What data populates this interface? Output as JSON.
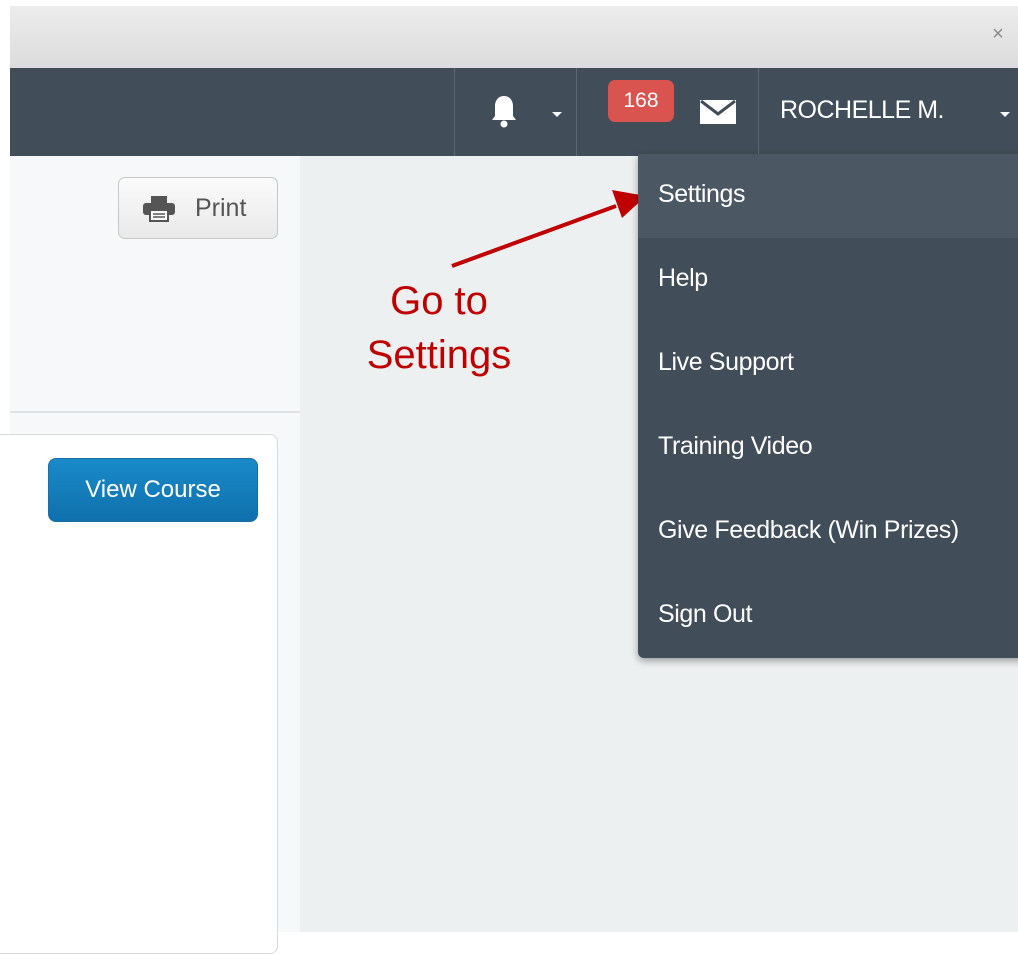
{
  "window": {
    "close_glyph": "×"
  },
  "navbar": {
    "notifications_icon": "bell-icon",
    "messages": {
      "badge_count": "168",
      "icon": "envelope-icon"
    },
    "user": {
      "name": "ROCHELLE M."
    }
  },
  "toolbar": {
    "print_label": "Print",
    "print_icon": "printer-icon"
  },
  "course_card": {
    "view_button_label": "View Course"
  },
  "annotation": {
    "line1": "Go to",
    "line2": "Settings",
    "color": "#c00000"
  },
  "user_menu": {
    "items": [
      {
        "label": "Settings"
      },
      {
        "label": "Help"
      },
      {
        "label": "Live Support"
      },
      {
        "label": "Training Video"
      },
      {
        "label": "Give Feedback (Win Prizes)"
      },
      {
        "label": "Sign Out"
      }
    ]
  },
  "colors": {
    "navbar": "#414d58",
    "badge": "#d9534f",
    "primary_button": "#1a7fbf"
  }
}
